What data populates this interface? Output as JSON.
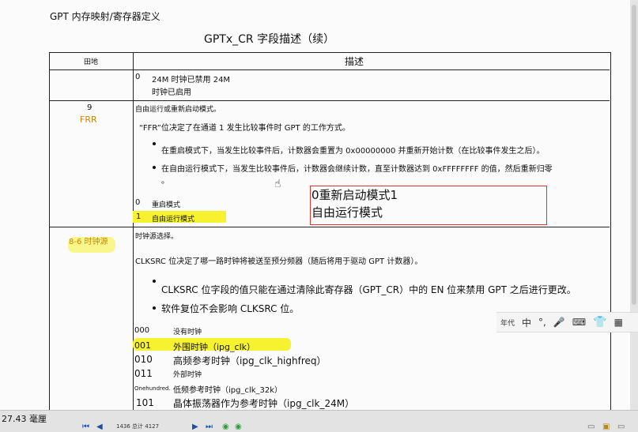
{
  "header": {
    "title": "GPT 内存映射/寄存器定义"
  },
  "table": {
    "title": "GPTx_CR 字段描述（续）",
    "col_field": "田地",
    "col_desc": "描述"
  },
  "row0": {
    "bit": "0",
    "line1": "24M 时钟已禁用 24M",
    "line2": "时钟已启用"
  },
  "row_frr": {
    "bit": "9",
    "field": "FRR",
    "summary": "自由运行或重新启动模式。",
    "intro": "“FFR”位决定了在通道 1 发生比较事件时 GPT 的工作方式。",
    "bullet1": "在重启模式下，当发生比较事件后，计数器会重置为 0x00000000 并重新开始计数（在比较事件发生之后）。",
    "bullet2": "在自由运行模式下，当发生比较事件后，计数器会继续计数，直至计数器达到 0xFFFFFFFF 的值，然后重新归零",
    "bullet2_cont": "。",
    "opt0_code": "0",
    "opt0_text": "重启模式",
    "opt1_code": "1",
    "opt1_text": "自由运行模式"
  },
  "annotation": {
    "line1": "0重新启动模式1",
    "line2": "自由运行模式"
  },
  "row_clksrc": {
    "field": "8-6 时钟源",
    "summary": "时钟源选择。",
    "intro": "CLKSRC 位决定了哪一路时钟将被送至预分频器（随后将用于驱动 GPT 计数器）。",
    "bullet1": "CLKSRC 位字段的值只能在通过清除此寄存器（GPT_CR）中的 EN 位来禁用 GPT 之后进行更改。",
    "bullet2": "软件复位不会影响 CLKSRC 位。",
    "options": [
      {
        "code": "000",
        "text": "没有时钟"
      },
      {
        "code": "001",
        "text": "外围时钟（ipg_clk）"
      },
      {
        "code": "010",
        "text": "高频参考时钟（ipg_clk_highfreq）"
      },
      {
        "code": "011",
        "text": "外部时钟"
      },
      {
        "code": "Onehundred.",
        "text": "低频参考时钟（ipg_clk_32k）"
      },
      {
        "code": "101",
        "text": "晶体振荡器作为参考时钟（ipg_clk_24M）"
      }
    ]
  },
  "ime": {
    "label": "年代",
    "lang": "中"
  },
  "status": {
    "zoom": "27.43 毫厘",
    "page": "1436 总计 4127"
  }
}
